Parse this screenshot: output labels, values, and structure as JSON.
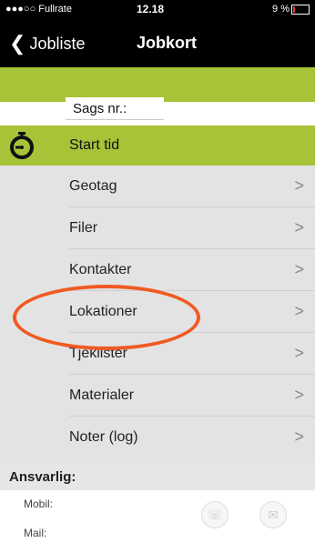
{
  "status_bar": {
    "carrier": "●●●○○ Fullrate",
    "time": "12.18",
    "battery": "9 %"
  },
  "nav": {
    "back_label": "Jobliste",
    "title": "Jobkort"
  },
  "form": {
    "sags_label": "Sags nr.:"
  },
  "start": {
    "label": "Start tid"
  },
  "menu": {
    "items": [
      {
        "label": "Geotag"
      },
      {
        "label": "Filer"
      },
      {
        "label": "Kontakter"
      },
      {
        "label": "Lokationer"
      },
      {
        "label": "Tjeklister"
      },
      {
        "label": "Materialer"
      },
      {
        "label": "Noter (log)"
      }
    ]
  },
  "responsible": {
    "heading": "Ansvarlig:",
    "mobil_label": "Mobil:",
    "mail_label": "Mail:"
  },
  "colors": {
    "green": "#a7c338",
    "highlight": "#f05a22"
  }
}
